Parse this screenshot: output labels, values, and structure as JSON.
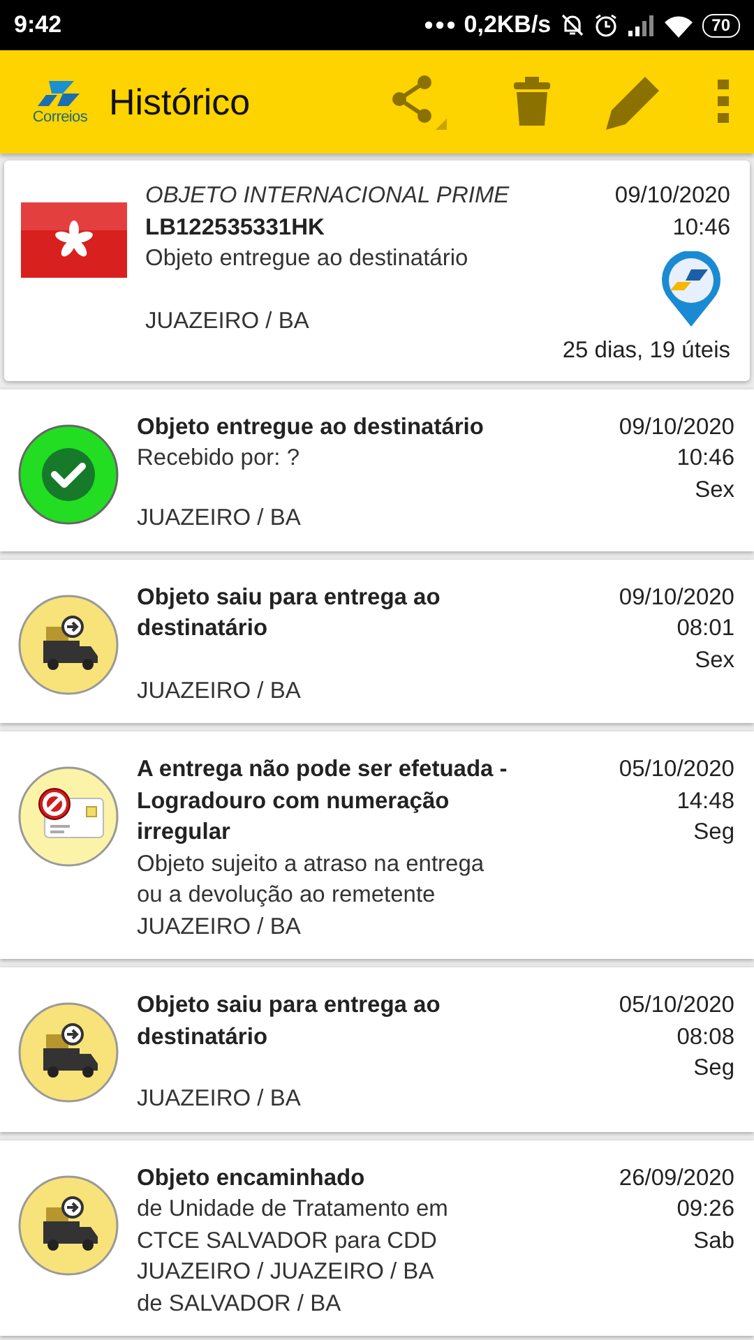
{
  "status_bar": {
    "time": "9:42",
    "speed": "0,2KB/s",
    "battery": "70"
  },
  "app_bar": {
    "logo_text": "Correios",
    "title": "Histórico"
  },
  "summary": {
    "service": "OBJETO INTERNACIONAL PRIME",
    "code": "LB122535331HK",
    "status": "Objeto entregue ao destinatário",
    "location": "JUAZEIRO / BA",
    "date": "09/10/2020",
    "time": "10:46",
    "elapsed": "25 dias, 19 úteis"
  },
  "events": [
    {
      "kind": "delivered",
      "title": "Objeto entregue ao destinatário",
      "details": [
        "Recebido por: ?"
      ],
      "location": "JUAZEIRO / BA",
      "date": "09/10/2020",
      "time": "10:46",
      "weekday": "Sex"
    },
    {
      "kind": "truck",
      "title": "Objeto saiu para entrega ao destinatário",
      "location": "JUAZEIRO / BA",
      "date": "09/10/2020",
      "time": "08:01",
      "weekday": "Sex"
    },
    {
      "kind": "blocked",
      "title": "A entrega não pode ser efetuada - Logradouro com numeração irregular",
      "details": [
        "Objeto sujeito a atraso na entrega",
        "ou a devolução ao remetente"
      ],
      "location": "JUAZEIRO / BA",
      "date": "05/10/2020",
      "time": "14:48",
      "weekday": "Seg"
    },
    {
      "kind": "truck",
      "title": "Objeto saiu para entrega ao destinatário",
      "location": "JUAZEIRO / BA",
      "date": "05/10/2020",
      "time": "08:08",
      "weekday": "Seg"
    },
    {
      "kind": "truck",
      "title": "Objeto encaminhado",
      "details": [
        "de Unidade de Tratamento em",
        "CTCE SALVADOR para CDD",
        "JUAZEIRO / JUAZEIRO / BA"
      ],
      "location": "de SALVADOR / BA",
      "date": "26/09/2020",
      "time": "09:26",
      "weekday": "Sab"
    }
  ]
}
